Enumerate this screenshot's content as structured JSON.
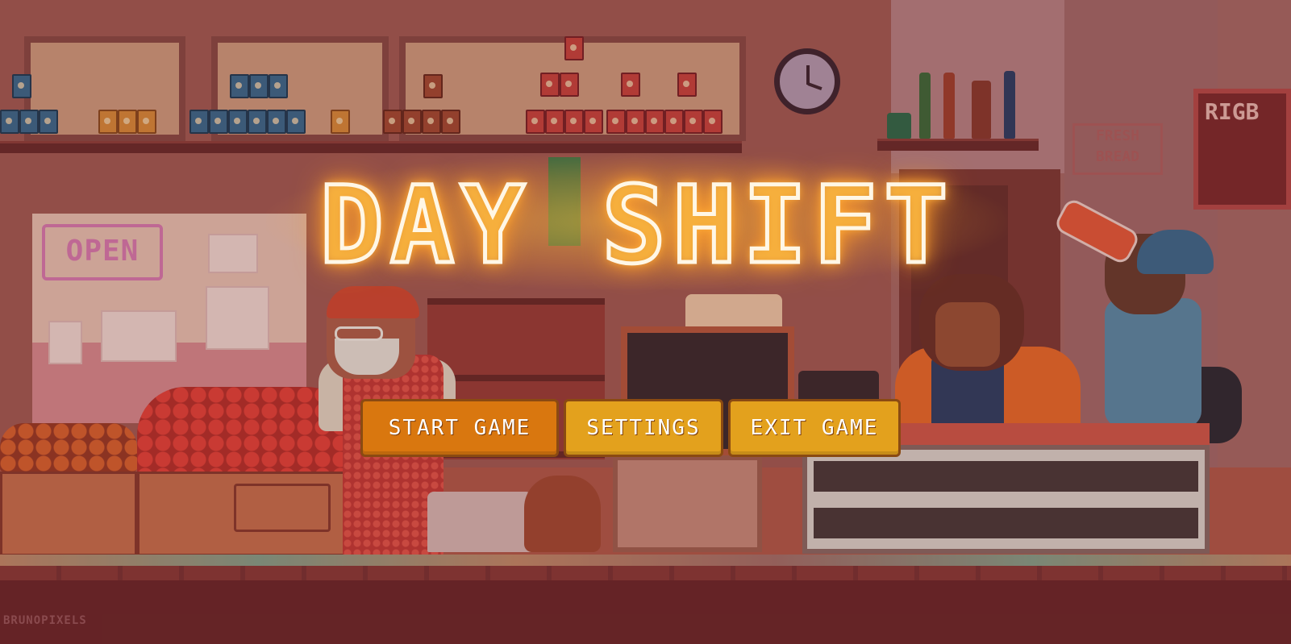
{
  "game": {
    "title": "DAY SHIFT"
  },
  "menu": {
    "start_label": "START GAME",
    "settings_label": "SETTINGS",
    "exit_label": "EXIT GAME"
  },
  "scene": {
    "open_sign": "OPEN",
    "board_text": "RIGB",
    "fresh_sign": "FRESH BREAD",
    "artist_credit": "BRUNOPIXELS"
  },
  "colors": {
    "start_button": "#d9770f",
    "secondary_button": "#e3a11d",
    "title_glow": "#ffb43a",
    "floor": "#6c272a"
  },
  "icons": [
    "clock-icon"
  ]
}
